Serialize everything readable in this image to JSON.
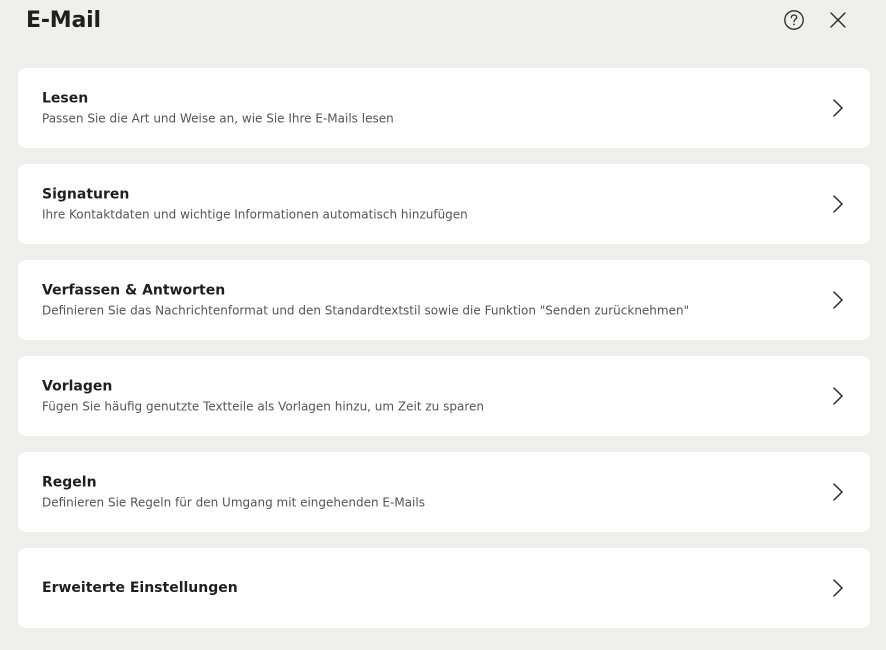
{
  "header": {
    "title": "E-Mail",
    "help_icon": "question-circle-icon",
    "close_icon": "close-icon"
  },
  "items": [
    {
      "title": "Lesen",
      "description": "Passen Sie die Art und Weise an, wie Sie Ihre E-Mails lesen",
      "icon": "chevron-right-icon"
    },
    {
      "title": "Signaturen",
      "description": "Ihre Kontaktdaten und wichtige Informationen automatisch hinzufügen",
      "icon": "chevron-right-icon"
    },
    {
      "title": "Verfassen & Antworten",
      "description": "Definieren Sie das Nachrichtenformat und den Standardtextstil sowie die Funktion \"Senden zurücknehmen\"",
      "icon": "chevron-right-icon"
    },
    {
      "title": "Vorlagen",
      "description": "Fügen Sie häufig genutzte Textteile als Vorlagen hinzu, um Zeit zu sparen",
      "icon": "chevron-right-icon"
    },
    {
      "title": "Regeln",
      "description": "Definieren Sie Regeln für den Umgang mit eingehenden E-Mails",
      "icon": "chevron-right-icon"
    },
    {
      "title": "Erweiterte Einstellungen",
      "description": "",
      "icon": "chevron-right-icon"
    }
  ],
  "colors": {
    "background": "#f0efec",
    "card": "#ffffff",
    "title_text": "#1f1f1f",
    "description_text": "#555555"
  }
}
